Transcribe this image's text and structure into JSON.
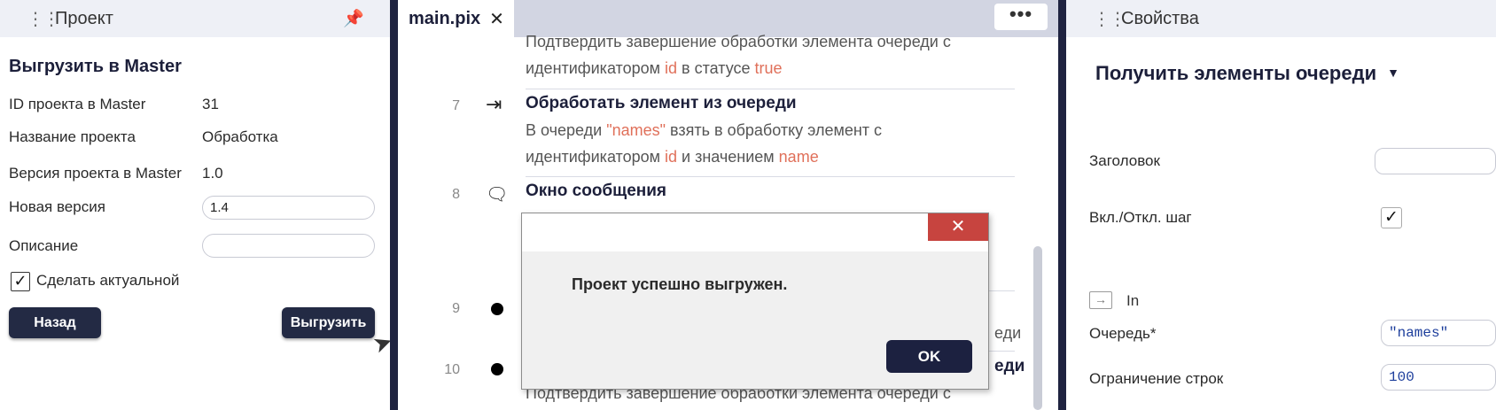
{
  "left_panel": {
    "title": "Проект",
    "section_title": "Выгрузить в Master",
    "fields": [
      {
        "label": "ID проекта в Master",
        "value": "31"
      },
      {
        "label": "Название проекта",
        "value": "Обработка"
      },
      {
        "label": "Версия проекта в Master",
        "value": "1.0"
      }
    ],
    "new_version_label": "Новая версия",
    "new_version_value": "1.4",
    "description_label": "Описание",
    "description_value": "",
    "make_current_label": "Сделать актуальной",
    "back_button": "Назад",
    "upload_button": "Выгрузить"
  },
  "editor": {
    "tab_name": "main.pix",
    "tab_close": "✕",
    "more": "•••",
    "top_step": {
      "desc_line1": "Подтвердить завершение обработки элемента очереди с",
      "desc_line2_a": "идентификатором ",
      "desc_line2_hl1": "id",
      "desc_line2_b": " в статусе ",
      "desc_line2_hl2": "true"
    },
    "step7": {
      "num": "7",
      "title": "Обработать элемент из очереди",
      "l1_a": "В очереди ",
      "l1_hl": "\"names\"",
      "l1_b": " взять в обработку элемент с",
      "l2_a": "идентификатором ",
      "l2_hl1": "id",
      "l2_b": " и значением ",
      "l2_hl2": "name"
    },
    "step8": {
      "num": "8",
      "title": "Окно сообщения"
    },
    "step9": {
      "num": "9",
      "tail": "еди"
    },
    "step10": {
      "num": "10",
      "tail": "еди",
      "desc": "Подтвердить завершение обработки элемента очереди с"
    }
  },
  "dialog": {
    "close": "✕",
    "message": "Проект успешно выгружен.",
    "ok": "OK"
  },
  "right_panel": {
    "title": "Свойства",
    "action_title": "Получить элементы очереди",
    "caret": "▼",
    "header_label": "Заголовок",
    "header_value": "",
    "toggle_label": "Вкл./Откл. шаг",
    "in_label": "In",
    "queue_label": "Очередь*",
    "queue_value": "\"names\"",
    "limit_label": "Ограничение строк",
    "limit_value": "100"
  }
}
